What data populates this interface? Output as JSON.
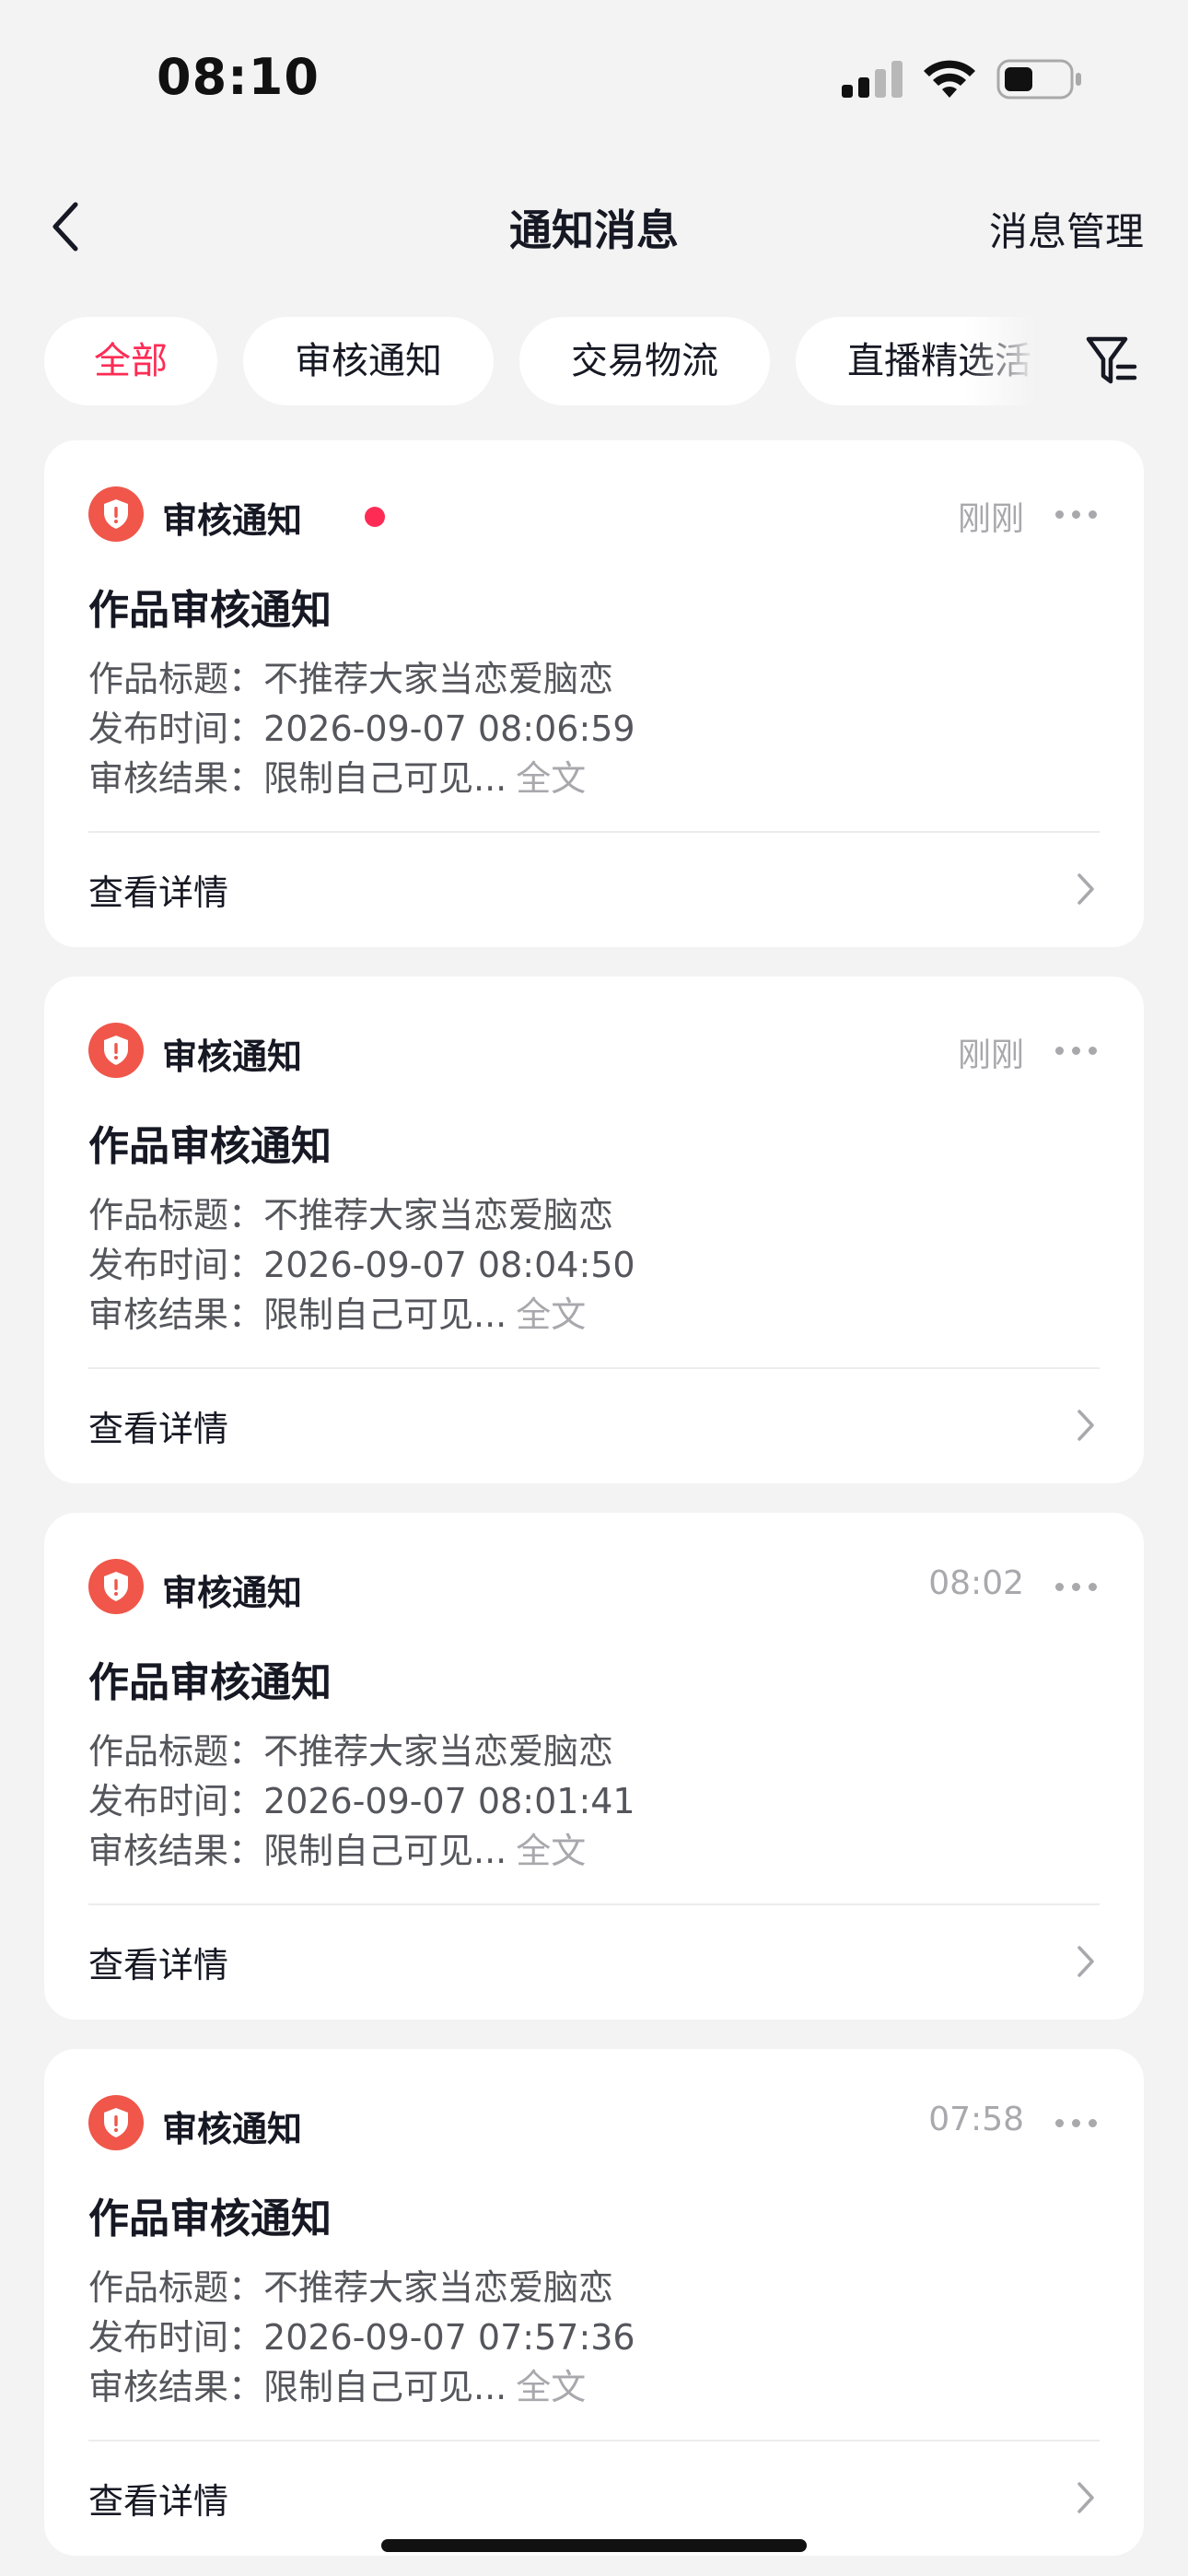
{
  "status_bar": {
    "time": "08:10"
  },
  "nav": {
    "title": "通知消息",
    "manage_label": "消息管理"
  },
  "tabs": [
    {
      "label": "全部",
      "active": true
    },
    {
      "label": "审核通知",
      "active": false
    },
    {
      "label": "交易物流",
      "active": false
    },
    {
      "label": "直播精选活",
      "active": false
    }
  ],
  "labels": {
    "title_key": "作品标题：",
    "publish_key": "发布时间：",
    "result_key": "审核结果：",
    "full_text": "全文",
    "view_detail": "查看详情"
  },
  "notifications": [
    {
      "category": "审核通知",
      "unread": true,
      "time": "刚刚",
      "title": "作品审核通知",
      "work_title": "不推荐大家当恋爱脑恋",
      "publish_time": "2026-09-07 08:06:59",
      "result": "限制自己可见..."
    },
    {
      "category": "审核通知",
      "unread": false,
      "time": "刚刚",
      "title": "作品审核通知",
      "work_title": "不推荐大家当恋爱脑恋",
      "publish_time": "2026-09-07 08:04:50",
      "result": "限制自己可见..."
    },
    {
      "category": "审核通知",
      "unread": false,
      "time": "08:02",
      "title": "作品审核通知",
      "work_title": "不推荐大家当恋爱脑恋",
      "publish_time": "2026-09-07 08:01:41",
      "result": "限制自己可见..."
    },
    {
      "category": "审核通知",
      "unread": false,
      "time": "07:58",
      "title": "作品审核通知",
      "work_title": "不推荐大家当恋爱脑恋",
      "publish_time": "2026-09-07 07:57:36",
      "result": "限制自己可见..."
    }
  ],
  "colors": {
    "accent": "#fe2c55",
    "shield": "#f0564a",
    "background": "#f3f3f3"
  }
}
